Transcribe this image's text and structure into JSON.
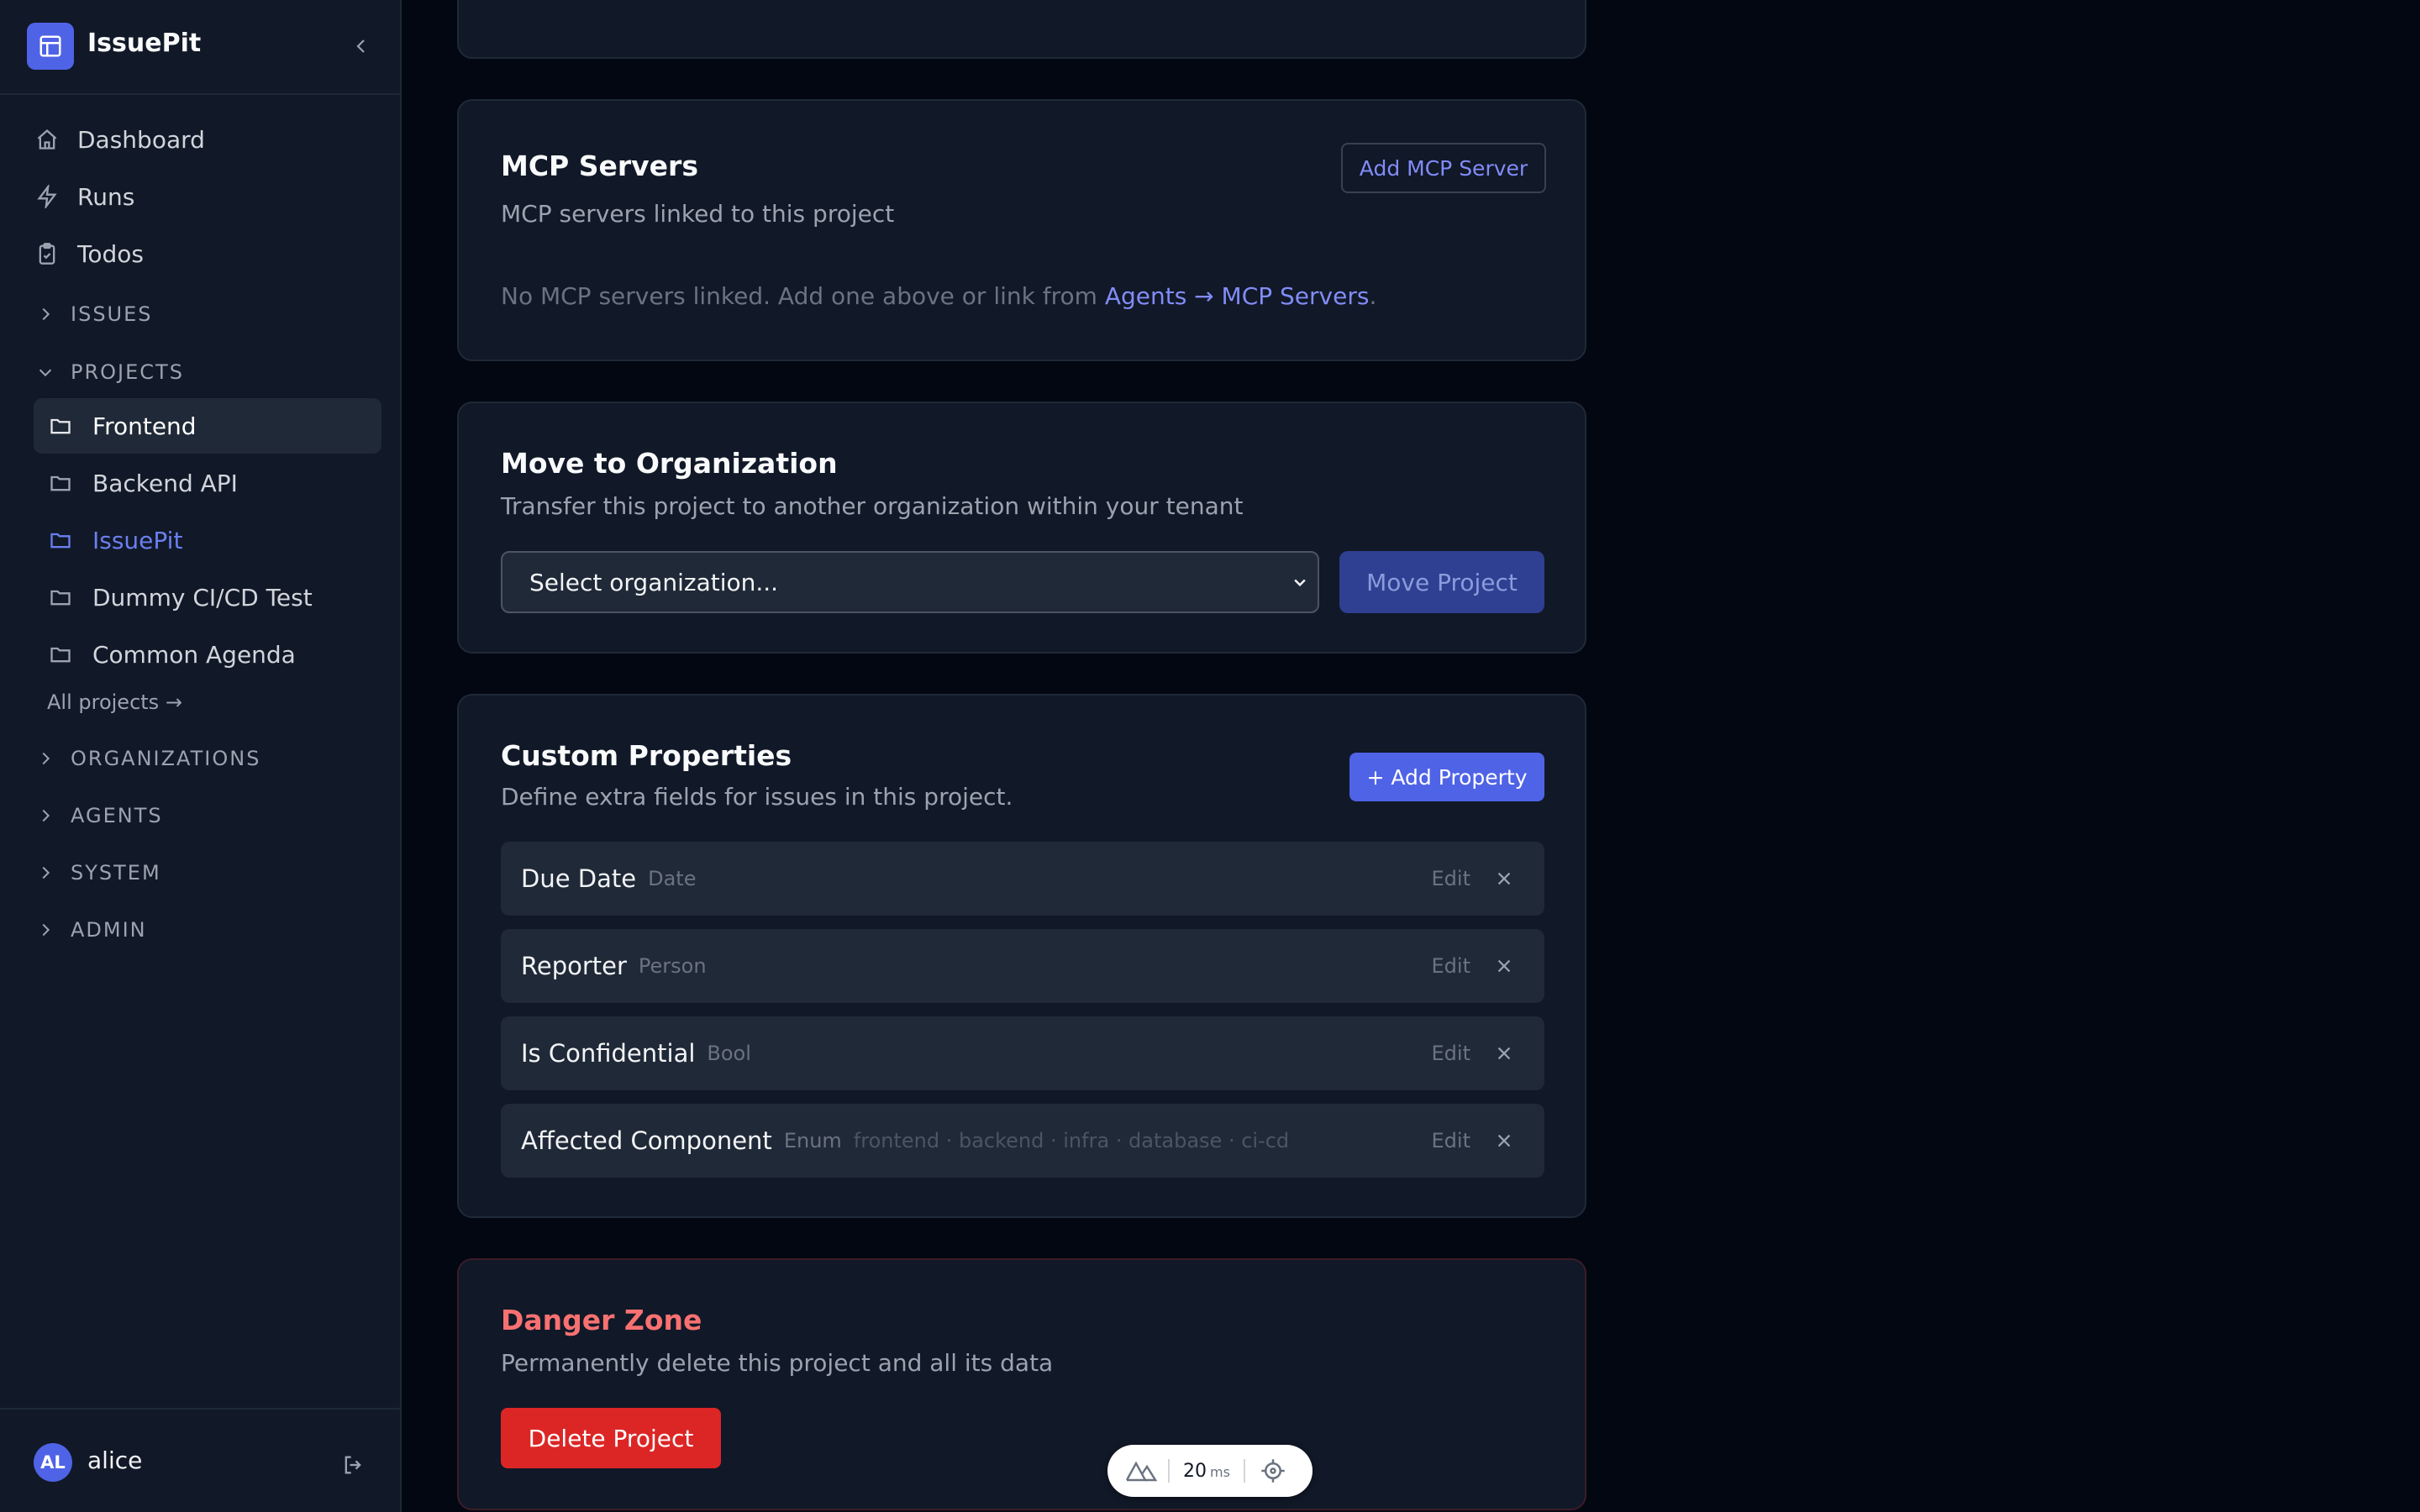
{
  "app": {
    "name": "IssuePit"
  },
  "nav": {
    "items": [
      {
        "label": "Dashboard",
        "icon": "home-icon"
      },
      {
        "label": "Runs",
        "icon": "bolt-icon"
      },
      {
        "label": "Todos",
        "icon": "clipboard-icon"
      }
    ],
    "sections": {
      "issues": "ISSUES",
      "projects": "PROJECTS",
      "organizations": "ORGANIZATIONS",
      "agents": "AGENTS",
      "system": "SYSTEM",
      "admin": "ADMIN"
    },
    "projects": [
      {
        "label": "Frontend",
        "state": "active"
      },
      {
        "label": "Backend API",
        "state": ""
      },
      {
        "label": "IssuePit",
        "state": "current"
      },
      {
        "label": "Dummy CI/CD Test",
        "state": ""
      },
      {
        "label": "Common Agenda",
        "state": ""
      }
    ],
    "all_projects": "All projects →"
  },
  "user": {
    "initials": "AL",
    "name": "alice"
  },
  "mcp": {
    "title": "MCP Servers",
    "description": "MCP servers linked to this project",
    "add_button": "Add MCP Server",
    "empty_text": "No MCP servers linked. Add one above or link from ",
    "empty_link": "Agents → MCP Servers",
    "empty_suffix": "."
  },
  "move": {
    "title": "Move to Organization",
    "description": "Transfer this project to another organization within your tenant",
    "select_value": "Select organization...",
    "button": "Move Project"
  },
  "custom_props": {
    "title": "Custom Properties",
    "description": "Define extra fields for issues in this project.",
    "add_button": "+ Add Property",
    "edit_label": "Edit",
    "items": [
      {
        "name": "Due Date",
        "type": "Date",
        "options": ""
      },
      {
        "name": "Reporter",
        "type": "Person",
        "options": ""
      },
      {
        "name": "Is Confidential",
        "type": "Bool",
        "options": ""
      },
      {
        "name": "Affected Component",
        "type": "Enum",
        "options": "frontend · backend · infra · database · ci-cd"
      }
    ]
  },
  "danger": {
    "title": "Danger Zone",
    "description": "Permanently delete this project and all its data",
    "button": "Delete Project"
  },
  "devtools": {
    "ms_value": "20",
    "ms_unit": "ms"
  },
  "colors": {
    "accent": "#4f63e6",
    "danger": "#dc2626",
    "link": "#818cf8",
    "background": "#030712",
    "card": "#111827"
  }
}
